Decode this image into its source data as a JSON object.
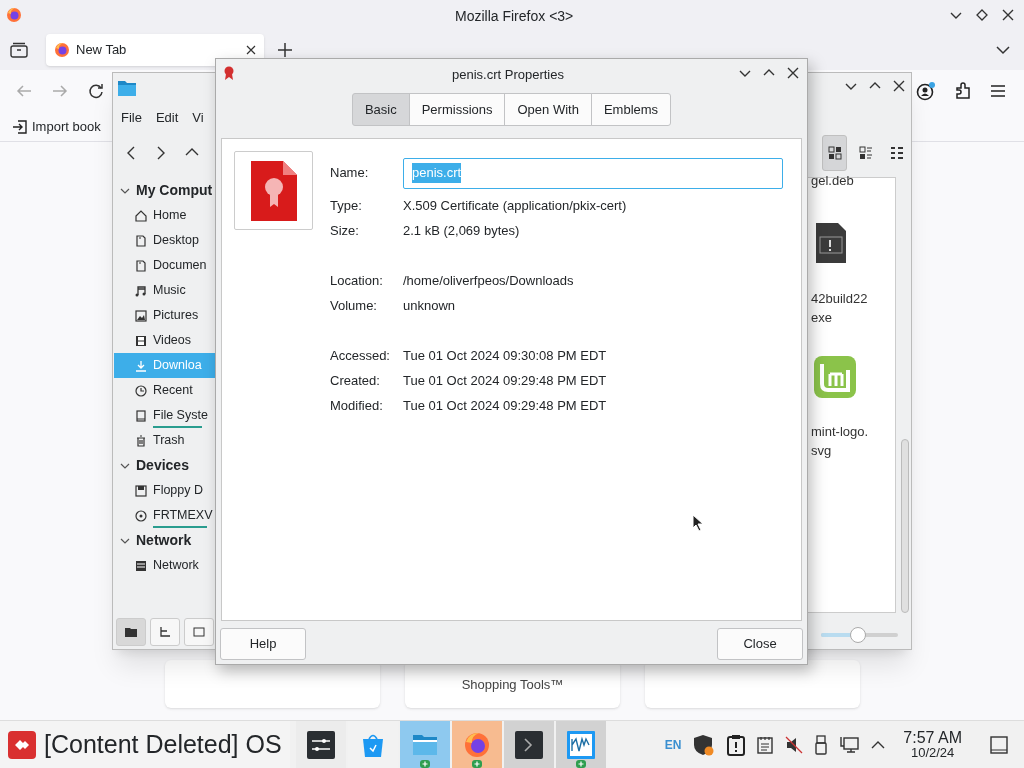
{
  "browser": {
    "title": "Mozilla Firefox <3>",
    "tabs": [
      {
        "label": "New Tab",
        "selected": true
      }
    ],
    "bookmarks": [
      "Import book"
    ],
    "cards": [
      "Shopping Tools™"
    ]
  },
  "file_manager": {
    "menu": [
      "File",
      "Edit",
      "Vi"
    ],
    "sidebar": [
      {
        "label": "My Comput",
        "expanded": true,
        "children": [
          {
            "label": "Home",
            "selected": false
          },
          {
            "label": "Desktop",
            "selected": false
          },
          {
            "label": "Documen",
            "selected": false
          },
          {
            "label": "Music",
            "selected": false
          },
          {
            "label": "Pictures",
            "selected": false
          },
          {
            "label": "Videos",
            "selected": false
          },
          {
            "label": "Downloa",
            "selected": true
          },
          {
            "label": "Recent",
            "selected": false
          },
          {
            "label": "File Syste",
            "selected": false,
            "mounted": true
          },
          {
            "label": "Trash",
            "selected": false
          }
        ]
      },
      {
        "label": "Devices",
        "expanded": true,
        "children": [
          {
            "label": "Floppy D",
            "selected": false
          },
          {
            "label": "FRTMEXV",
            "selected": false,
            "mounted": true
          }
        ]
      },
      {
        "label": "Network",
        "expanded": true,
        "children": [
          {
            "label": "Network",
            "selected": false
          }
        ]
      }
    ],
    "files": [
      {
        "lines": [
          "gel.deb"
        ]
      },
      {
        "lines": [
          "42build22",
          "exe"
        ]
      },
      {
        "lines": [
          "mint-logo.",
          "svg"
        ]
      }
    ],
    "views": [
      {
        "selected": true
      },
      {
        "selected": false
      },
      {
        "selected": false
      }
    ],
    "zoom": {
      "level": 0.48
    }
  },
  "dialog": {
    "title": "penis.crt Properties",
    "tabs": [
      {
        "label": "Basic",
        "selected": true
      },
      {
        "label": "Permissions",
        "selected": false
      },
      {
        "label": "Open With",
        "selected": false
      },
      {
        "label": "Emblems",
        "selected": false
      }
    ],
    "name": {
      "label": "Name:",
      "value": "penis.crt"
    },
    "groups": [
      [
        {
          "label": "Type:",
          "value": "X.509 Certificate (application/pkix-cert)"
        },
        {
          "label": "Size:",
          "value": "2.1 kB (2,069 bytes)"
        }
      ],
      [
        {
          "label": "Location:",
          "value": "/home/oliverfpeos/Downloads"
        },
        {
          "label": "Volume:",
          "value": "unknown"
        }
      ],
      [
        {
          "label": "Accessed:",
          "value": "Tue 01 Oct 2024 09:30:08 PM EDT"
        },
        {
          "label": "Created:",
          "value": "Tue 01 Oct 2024 09:29:48 PM EDT"
        },
        {
          "label": "Modified:",
          "value": "Tue 01 Oct 2024 09:29:48 PM EDT"
        }
      ]
    ],
    "buttons": [
      "Help",
      "Close"
    ]
  },
  "taskbar": {
    "start": "[Content Deleted] OS",
    "apps": [
      {
        "color": "#ececec",
        "running": false
      },
      {
        "color": "#f2f2f2",
        "running": false
      },
      {
        "color": "#8ec9ef",
        "running": true
      },
      {
        "color": "#f7bb90",
        "running": true
      },
      {
        "color": "#d2d2d2",
        "running": false
      },
      {
        "color": "#d2d2d2",
        "running": true
      }
    ],
    "language": "EN",
    "time": "7:57 AM",
    "date": "10/2/24"
  }
}
